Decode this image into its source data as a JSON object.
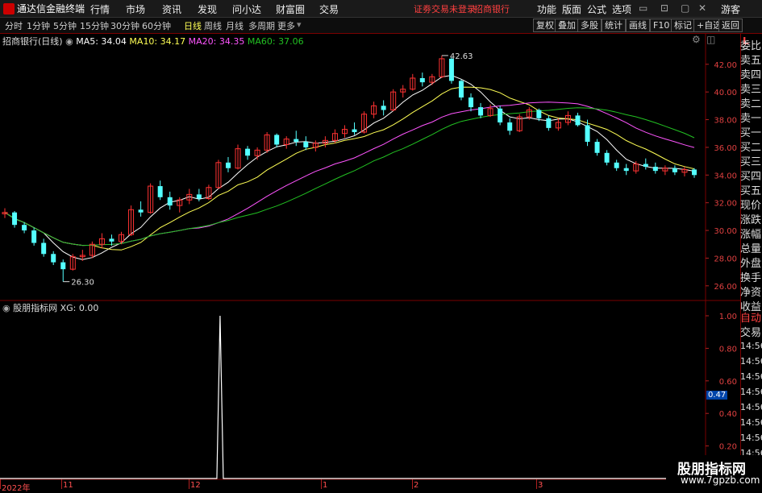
{
  "menubar": {
    "app_title": "通达信金融终端",
    "items": [
      "行情",
      "市场",
      "资讯",
      "发现",
      "问小达",
      "财富圈",
      "交易"
    ],
    "status_warn": "证劵交易未登录",
    "broker": "招商银行",
    "right_items": [
      "功能",
      "版面",
      "公式",
      "选项"
    ],
    "user": "游客"
  },
  "toolbar": {
    "periods": [
      "分时",
      "1分钟",
      "5分钟",
      "15分钟",
      "30分钟",
      "60分钟",
      "日线",
      "周线",
      "月线",
      "多周期",
      "更多"
    ],
    "active_period": "日线",
    "right_buttons": [
      "复权",
      "叠加",
      "多股",
      "统计",
      "画线",
      "F10",
      "标记",
      "+自选",
      "返回"
    ]
  },
  "chart_legend": {
    "stock": "招商银行(日线)",
    "ma5": "MA5: 34.04",
    "ma10": "MA10: 34.17",
    "ma20": "MA20: 34.35",
    "ma60": "MA60: 37.06"
  },
  "sub_legend": {
    "indicator": "股朋指标网",
    "xg": "XG: 0.00"
  },
  "chart_data": [
    {
      "type": "candlestick",
      "title": "招商银行(日线)",
      "yticks": [
        "42.00",
        "40.00",
        "38.00",
        "36.00",
        "34.00",
        "32.00",
        "30.00",
        "28.00",
        "26.00"
      ],
      "ylim": [
        25,
        43.5
      ],
      "annotations": [
        {
          "label": "42.63",
          "value": 42.63
        },
        {
          "label": "26.30",
          "value": 26.3
        }
      ],
      "x_labels": [
        "2022年",
        "11",
        "12",
        "1",
        "2",
        "3"
      ],
      "candles": [
        [
          31.2,
          31.6,
          30.9,
          31.3
        ],
        [
          31.3,
          31.4,
          30.2,
          30.4
        ],
        [
          30.4,
          30.6,
          29.8,
          30.0
        ],
        [
          30.0,
          30.2,
          28.9,
          29.1
        ],
        [
          29.1,
          29.4,
          28.1,
          28.3
        ],
        [
          28.3,
          28.5,
          27.5,
          27.7
        ],
        [
          27.7,
          27.9,
          26.3,
          27.2
        ],
        [
          27.2,
          28.3,
          27.1,
          28.1
        ],
        [
          28.1,
          28.6,
          27.8,
          28.2
        ],
        [
          28.2,
          29.2,
          28.0,
          29.0
        ],
        [
          29.0,
          29.8,
          28.7,
          29.4
        ],
        [
          29.4,
          29.7,
          28.9,
          29.2
        ],
        [
          29.2,
          29.9,
          29.0,
          29.7
        ],
        [
          29.7,
          31.8,
          29.6,
          31.5
        ],
        [
          31.5,
          32.1,
          31.0,
          31.3
        ],
        [
          31.3,
          33.4,
          31.2,
          33.2
        ],
        [
          33.2,
          33.6,
          32.2,
          32.4
        ],
        [
          32.4,
          32.8,
          31.5,
          31.8
        ],
        [
          31.8,
          32.4,
          31.3,
          32.2
        ],
        [
          32.2,
          33.0,
          31.9,
          32.6
        ],
        [
          32.6,
          33.0,
          32.1,
          32.3
        ],
        [
          32.3,
          33.3,
          32.2,
          33.1
        ],
        [
          33.1,
          35.1,
          33.0,
          34.9
        ],
        [
          34.9,
          35.3,
          34.2,
          34.5
        ],
        [
          34.5,
          36.2,
          34.4,
          35.9
        ],
        [
          35.9,
          36.1,
          35.1,
          35.4
        ],
        [
          35.4,
          36.0,
          35.1,
          35.8
        ],
        [
          35.8,
          37.1,
          35.6,
          36.9
        ],
        [
          36.9,
          37.0,
          36.0,
          36.2
        ],
        [
          36.2,
          36.8,
          35.9,
          36.6
        ],
        [
          36.6,
          37.2,
          36.1,
          36.4
        ],
        [
          36.4,
          36.8,
          35.8,
          36.0
        ],
        [
          36.0,
          36.5,
          35.7,
          36.3
        ],
        [
          36.3,
          36.8,
          36.0,
          36.5
        ],
        [
          36.5,
          37.3,
          36.3,
          37.0
        ],
        [
          37.0,
          37.6,
          36.7,
          37.3
        ],
        [
          37.3,
          37.8,
          36.9,
          37.1
        ],
        [
          37.1,
          38.6,
          37.0,
          38.4
        ],
        [
          38.4,
          39.3,
          38.1,
          39.0
        ],
        [
          39.0,
          39.4,
          38.3,
          38.7
        ],
        [
          38.7,
          40.2,
          38.6,
          40.0
        ],
        [
          40.0,
          40.5,
          39.6,
          40.2
        ],
        [
          40.2,
          41.3,
          40.1,
          41.0
        ],
        [
          41.0,
          41.4,
          40.4,
          40.7
        ],
        [
          40.7,
          41.3,
          40.5,
          41.1
        ],
        [
          41.1,
          42.63,
          41.0,
          42.4
        ],
        [
          42.4,
          42.5,
          40.6,
          40.8
        ],
        [
          40.8,
          40.9,
          39.4,
          39.6
        ],
        [
          39.6,
          39.9,
          38.6,
          38.9
        ],
        [
          38.9,
          39.2,
          38.1,
          38.3
        ],
        [
          38.3,
          39.1,
          38.2,
          38.8
        ],
        [
          38.8,
          39.0,
          37.6,
          37.8
        ],
        [
          37.8,
          38.1,
          36.9,
          37.2
        ],
        [
          37.2,
          38.4,
          37.1,
          38.2
        ],
        [
          38.2,
          38.9,
          38.0,
          38.7
        ],
        [
          38.7,
          38.8,
          37.9,
          38.1
        ],
        [
          38.1,
          38.3,
          37.2,
          37.4
        ],
        [
          37.4,
          38.1,
          37.2,
          37.8
        ],
        [
          37.8,
          38.6,
          37.6,
          38.3
        ],
        [
          38.3,
          38.5,
          37.5,
          37.6
        ],
        [
          37.6,
          38.0,
          36.1,
          36.4
        ],
        [
          36.4,
          36.6,
          35.4,
          35.6
        ],
        [
          35.6,
          35.8,
          34.7,
          34.9
        ],
        [
          34.9,
          35.1,
          34.3,
          34.5
        ],
        [
          34.5,
          34.8,
          34.0,
          34.3
        ],
        [
          34.3,
          35.0,
          34.1,
          34.8
        ],
        [
          34.8,
          35.2,
          34.4,
          34.6
        ],
        [
          34.6,
          34.9,
          34.1,
          34.3
        ],
        [
          34.3,
          34.7,
          34.0,
          34.5
        ],
        [
          34.5,
          34.7,
          34.0,
          34.2
        ],
        [
          34.2,
          34.6,
          33.9,
          34.4
        ],
        [
          34.4,
          34.5,
          33.8,
          34.0
        ]
      ],
      "ma_lines": [
        {
          "name": "MA5",
          "color": "#ffffff"
        },
        {
          "name": "MA10",
          "color": "#ffff55"
        },
        {
          "name": "MA20",
          "color": "#ff55ff"
        },
        {
          "name": "MA60",
          "color": "#22c022"
        }
      ]
    },
    {
      "type": "line",
      "title": "股朋指标网",
      "yticks": [
        "1.00",
        "0.80",
        "0.60",
        "0.40",
        "0.20",
        "0.00"
      ],
      "ylim": [
        0,
        1
      ],
      "series": [
        {
          "name": "XG",
          "color": "#ffffff",
          "spike_index": 22,
          "values_note": "single spike"
        }
      ]
    }
  ],
  "right_panel": {
    "top": "L",
    "labels": [
      "委比",
      "卖五",
      "卖四",
      "卖三",
      "卖二",
      "卖一",
      "买一",
      "买二",
      "买三",
      "买四",
      "买五",
      "现价",
      "涨跌",
      "涨幅",
      "总量",
      "外盘",
      "换手",
      "净资",
      "收益"
    ],
    "sub_labels": [
      "自动",
      "交易"
    ],
    "times": [
      "14:56",
      "14:56",
      "14:56",
      "14:56",
      "14:56",
      "14:56",
      "14:56",
      "14:56",
      "14:56",
      "14:56"
    ],
    "marker": "0.47"
  },
  "watermark": {
    "title": "股朋指标网",
    "url": "www.7gpzb.com"
  }
}
